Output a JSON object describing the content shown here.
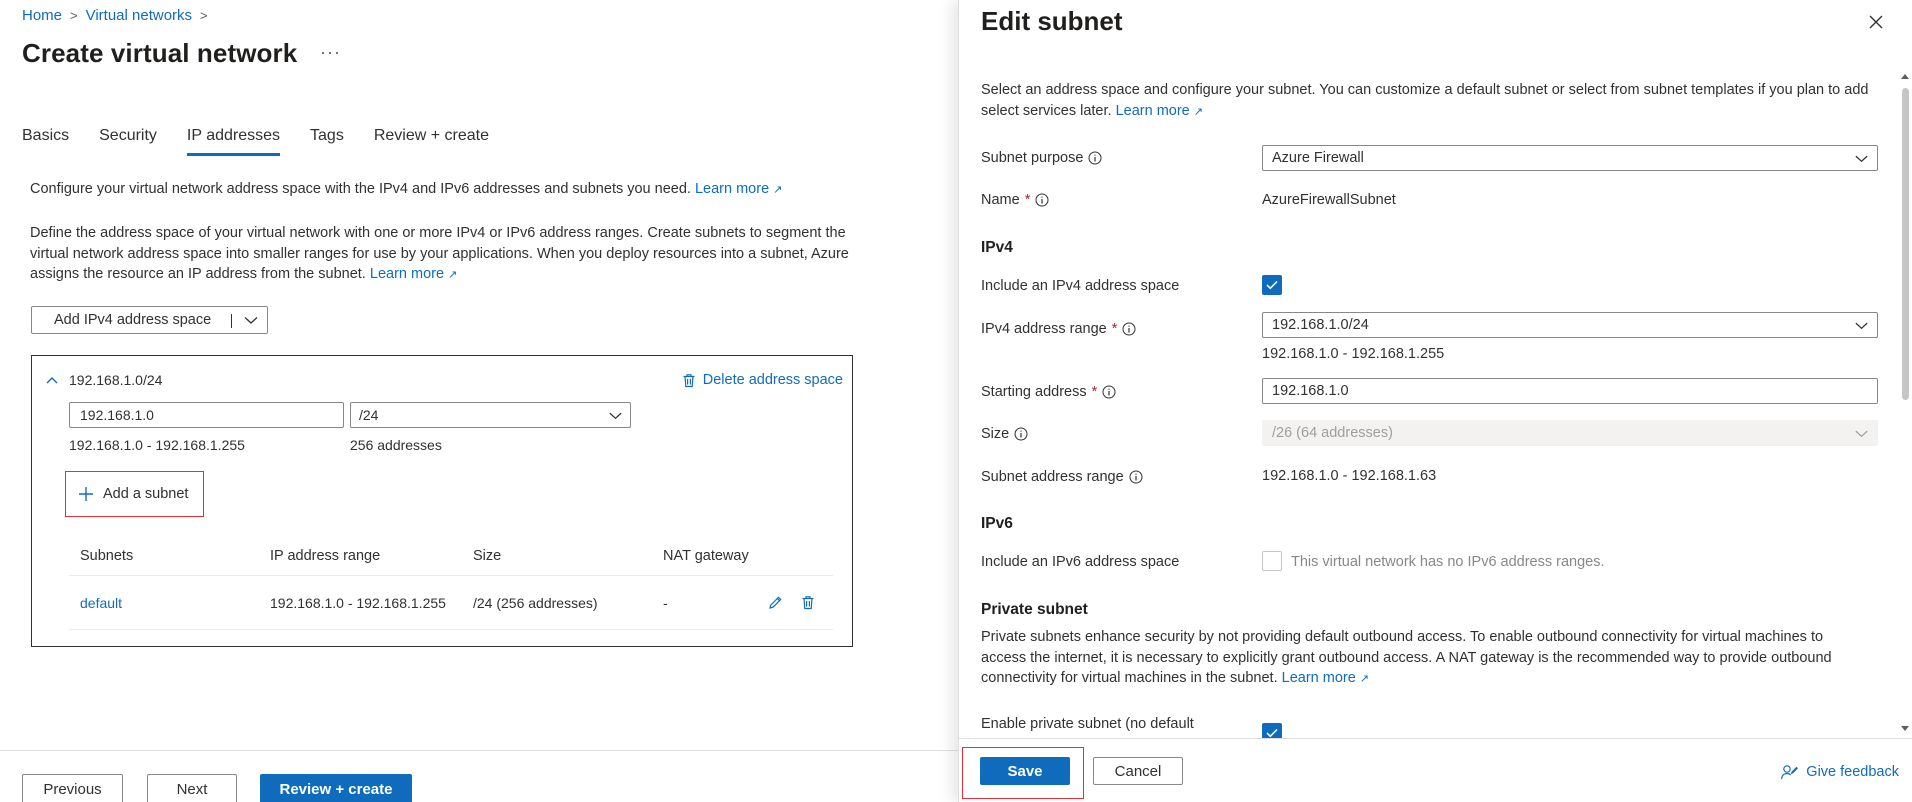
{
  "breadcrumb": {
    "home": "Home",
    "virtual_networks": "Virtual networks",
    "sep": ">"
  },
  "page": {
    "title": "Create virtual network",
    "more": "···"
  },
  "tabs": [
    {
      "label": "Basics",
      "active": false
    },
    {
      "label": "Security",
      "active": false
    },
    {
      "label": "IP addresses",
      "active": true
    },
    {
      "label": "Tags",
      "active": false
    },
    {
      "label": "Review + create",
      "active": false
    }
  ],
  "ip_page": {
    "desc1": "Configure your virtual network address space with the IPv4 and IPv6 addresses and subnets you need.",
    "desc2": "Define the address space of your virtual network with one or more IPv4 or IPv6 address ranges. Create subnets to segment the virtual network address space into smaller ranges for use by your applications. When you deploy resources into a subnet, Azure assigns the resource an IP address from the subnet.",
    "learn_more": "Learn more",
    "add_space_button": "Add IPv4 address space",
    "address_space": {
      "title": "192.168.1.0/24",
      "delete_label": "Delete address space",
      "ip_value": "192.168.1.0",
      "cidr_value": "/24",
      "range": "192.168.1.0 - 192.168.1.255",
      "count": "256 addresses"
    },
    "add_subnet_label": "Add a subnet",
    "table": {
      "headers": [
        "Subnets",
        "IP address range",
        "Size",
        "NAT gateway"
      ],
      "rows": [
        {
          "name": "default",
          "range": "192.168.1.0 - 192.168.1.255",
          "size": "/24 (256 addresses)",
          "nat": "-"
        }
      ]
    }
  },
  "footer": {
    "previous": "Previous",
    "next": "Next",
    "review": "Review + create"
  },
  "panel": {
    "title": "Edit subnet",
    "description": "Select an address space and configure your subnet. You can customize a default subnet or select from subnet templates if you plan to add select services later.",
    "learn_more": "Learn more",
    "subnet_purpose_label": "Subnet purpose",
    "subnet_purpose_value": "Azure Firewall",
    "name_label": "Name",
    "name_value": "AzureFirewallSubnet",
    "required_mark": "*",
    "ipv4_section": "IPv4",
    "include_ipv4_label": "Include an IPv4 address space",
    "include_ipv4_checked": true,
    "ipv4_range_label": "IPv4 address range",
    "ipv4_range_value": "192.168.1.0/24",
    "ipv4_range_span": "192.168.1.0 - 192.168.1.255",
    "starting_address_label": "Starting address",
    "starting_address_value": "192.168.1.0",
    "size_label": "Size",
    "size_value": "/26 (64 addresses)",
    "subnet_range_label": "Subnet address range",
    "subnet_range_value": "192.168.1.0 - 192.168.1.63",
    "ipv6_section": "IPv6",
    "include_ipv6_label": "Include an IPv6 address space",
    "include_ipv6_checked": false,
    "ipv6_note": "This virtual network has no IPv6 address ranges.",
    "private_section": "Private subnet",
    "private_desc": "Private subnets enhance security by not providing default outbound access. To enable outbound connectivity for virtual machines to access the internet, it is necessary to explicitly grant outbound access. A NAT gateway is the recommended way to provide outbound connectivity for virtual machines in the subnet.",
    "enable_private_label": "Enable private subnet (no default",
    "enable_private_checked": true,
    "save": "Save",
    "cancel": "Cancel",
    "feedback": "Give feedback"
  },
  "colors": {
    "accent": "#0f6cbd",
    "highlight": "#e0303a",
    "text": "#323130"
  }
}
